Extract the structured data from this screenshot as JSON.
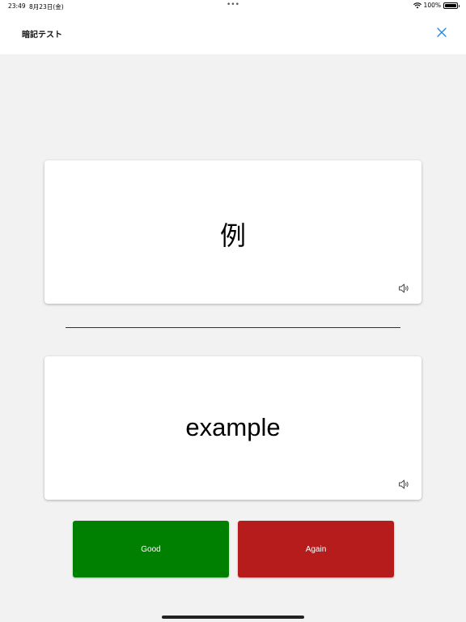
{
  "status_bar": {
    "time": "23:49",
    "date": "8月23日(金)",
    "battery": "100%"
  },
  "nav": {
    "title": "暗記テスト"
  },
  "front_card": {
    "text": "例"
  },
  "back_card": {
    "text": "example"
  },
  "buttons": {
    "good_label": "Good",
    "again_label": "Again"
  },
  "colors": {
    "good": "#008000",
    "again": "#b71c1c",
    "accent": "#1e88e5",
    "background": "#f2f2f2"
  },
  "icons": {
    "close": "close-icon",
    "speaker": "speaker-icon",
    "wifi": "wifi-icon",
    "battery": "battery-icon"
  }
}
